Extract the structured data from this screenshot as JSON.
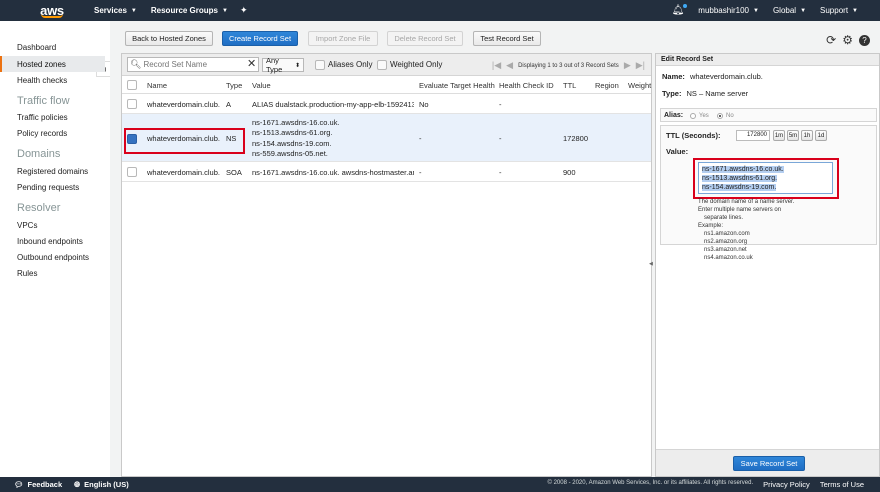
{
  "topnav": {
    "logo": "aws",
    "services": "Services",
    "resource_groups": "Resource Groups",
    "user": "mubbashir100",
    "region": "Global",
    "support": "Support"
  },
  "sidebar": {
    "items": [
      {
        "label": "Dashboard"
      },
      {
        "label": "Hosted zones"
      },
      {
        "label": "Health checks"
      }
    ],
    "traffic_flow": {
      "heading": "Traffic flow",
      "items": [
        "Traffic policies",
        "Policy records"
      ]
    },
    "domains": {
      "heading": "Domains",
      "items": [
        "Registered domains",
        "Pending requests"
      ]
    },
    "resolver": {
      "heading": "Resolver",
      "items": [
        "VPCs",
        "Inbound endpoints",
        "Outbound endpoints",
        "Rules"
      ]
    }
  },
  "toolbar": {
    "back": "Back to Hosted Zones",
    "create": "Create Record Set",
    "import": "Import Zone File",
    "delete": "Delete Record Set",
    "test": "Test Record Set"
  },
  "filter": {
    "search_placeholder": "Record Set Name",
    "type_select": "Any Type",
    "aliases_only": "Aliases Only",
    "weighted_only": "Weighted Only",
    "pager_text": "Displaying 1 to 3 out of 3 Record Sets"
  },
  "table": {
    "headers": [
      "Name",
      "Type",
      "Value",
      "Evaluate Target Health",
      "Health Check ID",
      "TTL",
      "Region",
      "Weight"
    ],
    "rows": [
      {
        "name": "whateverdomain.club.",
        "type": "A",
        "value": [
          "ALIAS dualstack.production-my-app-elb-159241318"
        ],
        "eval": "No",
        "hc": "-",
        "ttl": "",
        "selected": false
      },
      {
        "name": "whateverdomain.club.",
        "type": "NS",
        "value": [
          "ns-1671.awsdns-16.co.uk.",
          "ns-1513.awsdns-61.org.",
          "ns-154.awsdns-19.com.",
          "ns-559.awsdns-05.net."
        ],
        "eval": "-",
        "hc": "-",
        "ttl": "172800",
        "selected": true
      },
      {
        "name": "whateverdomain.club.",
        "type": "SOA",
        "value": [
          "ns-1671.awsdns-16.co.uk. awsdns-hostmaster.amaz"
        ],
        "eval": "-",
        "hc": "-",
        "ttl": "900",
        "selected": false
      }
    ]
  },
  "edit": {
    "title": "Edit Record Set",
    "name_label": "Name:",
    "name_value": "whateverdomain.club.",
    "type_label": "Type:",
    "type_value": "NS – Name server",
    "alias_label": "Alias:",
    "alias_yes": "Yes",
    "alias_no": "No",
    "ttl_label": "TTL (Seconds):",
    "ttl_value": "172800",
    "ttl_buttons": [
      "1m",
      "5m",
      "1h",
      "1d"
    ],
    "value_label": "Value:",
    "value_lines": [
      "ns-1671.awsdns-16.co.uk.",
      "ns-1513.awsdns-61.org.",
      "ns-154.awsdns-19.com."
    ],
    "hint_lines": [
      "The domain name of a name server.",
      "Enter multiple name servers on",
      "separate lines.",
      "Example:",
      "ns1.amazon.com",
      "ns2.amazon.org",
      "ns3.amazon.net",
      "ns4.amazon.co.uk"
    ],
    "save": "Save Record Set"
  },
  "footer": {
    "feedback": "Feedback",
    "language": "English (US)",
    "copyright": "© 2008 - 2020, Amazon Web Services, Inc. or its affiliates. All rights reserved.",
    "privacy": "Privacy Policy",
    "terms": "Terms of Use"
  }
}
